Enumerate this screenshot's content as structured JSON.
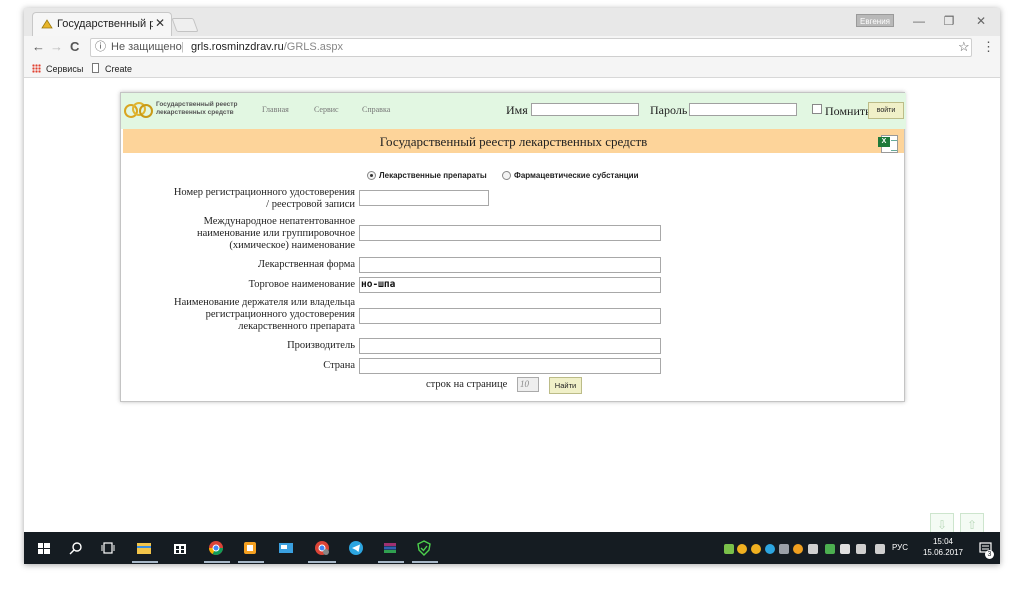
{
  "browser": {
    "tab_title": "Государственный реест",
    "tab_close": "✕",
    "profile": "Евгения",
    "window_controls": {
      "minimize": "—",
      "restore": "❐",
      "close": "✕"
    },
    "back": "←",
    "forward": "→",
    "reload": "C",
    "security_icon": "ⓘ",
    "security_text": "Не защищено",
    "separator": "|",
    "url_host": "grls.rosminzdrav.ru",
    "url_path": "/GRLS.aspx",
    "bookmark_star": "☆",
    "menu": "⋮",
    "bookmarks": [
      {
        "label": "Сервисы",
        "icon": "apps-icon"
      },
      {
        "label": "Create",
        "icon": "document-icon"
      }
    ]
  },
  "site": {
    "logo_text": "Государственный реестр лекарственных средств",
    "nav": [
      "Главная",
      "Сервис",
      "Справка"
    ],
    "login": {
      "name_label": "Имя",
      "name_value": "",
      "password_label": "Пароль",
      "password_value": "",
      "remember_label": "Помнить",
      "remember_checked": false,
      "login_button": "войти"
    },
    "title": "Государственный реестр лекарственных средств",
    "excel_icon": "X",
    "search_type": {
      "options": [
        "Лекарственные препараты",
        "Фармацевтические субстанции"
      ],
      "selected": "Лекарственные препараты"
    },
    "form": {
      "reg_number": {
        "label_lines": [
          "Номер регистрационного удостоверения",
          "/ реестровой записи"
        ],
        "value": ""
      },
      "inn": {
        "label_lines": [
          "Международное непатентованное",
          "наименование или группировочное",
          "(химическое) наименование"
        ],
        "value": ""
      },
      "dosage_form": {
        "label_lines": [
          "Лекарственная форма"
        ],
        "value": ""
      },
      "trade_name": {
        "label_lines": [
          "Торговое наименование"
        ],
        "value": "но-шпа"
      },
      "holder": {
        "label_lines": [
          "Наименование держателя или владельца",
          "регистрационного удостоверения",
          "лекарственного препарата"
        ],
        "value": ""
      },
      "manufacturer": {
        "label_lines": [
          "Производитель"
        ],
        "value": ""
      },
      "country": {
        "label_lines": [
          "Страна"
        ],
        "value": ""
      }
    },
    "rows_label": "строк на странице",
    "rows_value": "10",
    "search_button": "Найти",
    "scroll_down": "⇩",
    "scroll_up": "⇧"
  },
  "taskbar": {
    "language": "РУС",
    "time": "15:04",
    "date": "15.06.2017",
    "notification_count": "3",
    "accent_colors": {
      "chrome_tab_bg": "#f6f6f6",
      "site_header": "#e2f7e2",
      "title_bar": "#fdd49a",
      "taskbar": "#151c22"
    }
  }
}
